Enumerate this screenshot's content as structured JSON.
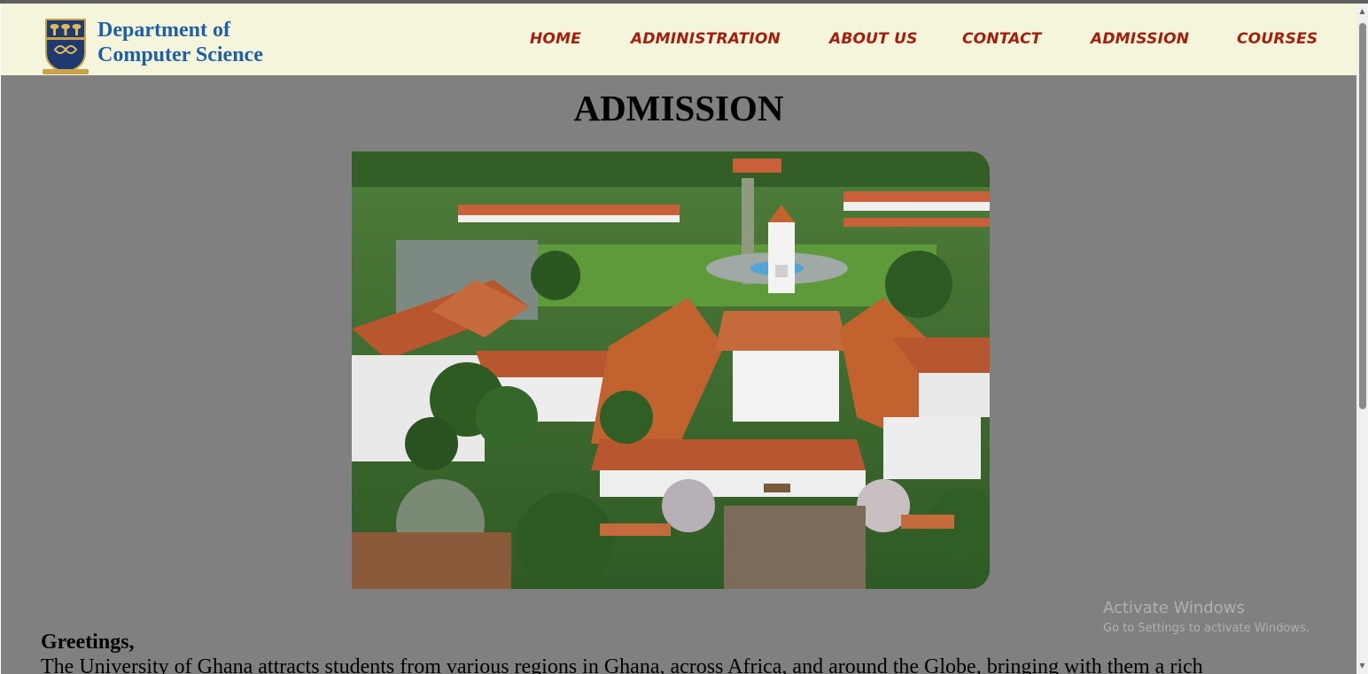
{
  "header": {
    "brand_line1": "Department of",
    "brand_line2": "Computer Science",
    "logo_icon": "university-crest-icon"
  },
  "nav": {
    "items": [
      "HOME",
      "ADMINISTRATION",
      "ABOUT US",
      "CONTACT",
      "ADMISSION",
      "COURSES"
    ]
  },
  "main": {
    "title": "ADMISSION",
    "hero_image": "campus-aerial-photo",
    "greeting": "Greetings,",
    "intro_text": "The University of Ghana attracts students from various regions in Ghana, across Africa, and around the Globe, bringing with them a rich"
  },
  "watermark": {
    "title": "Activate Windows",
    "subtitle": "Go to Settings to activate Windows."
  },
  "colors": {
    "header_bg": "#f5f5dc",
    "page_bg": "#808080",
    "nav_text": "#a51e0b",
    "brand_text": "#1f5fa8"
  }
}
